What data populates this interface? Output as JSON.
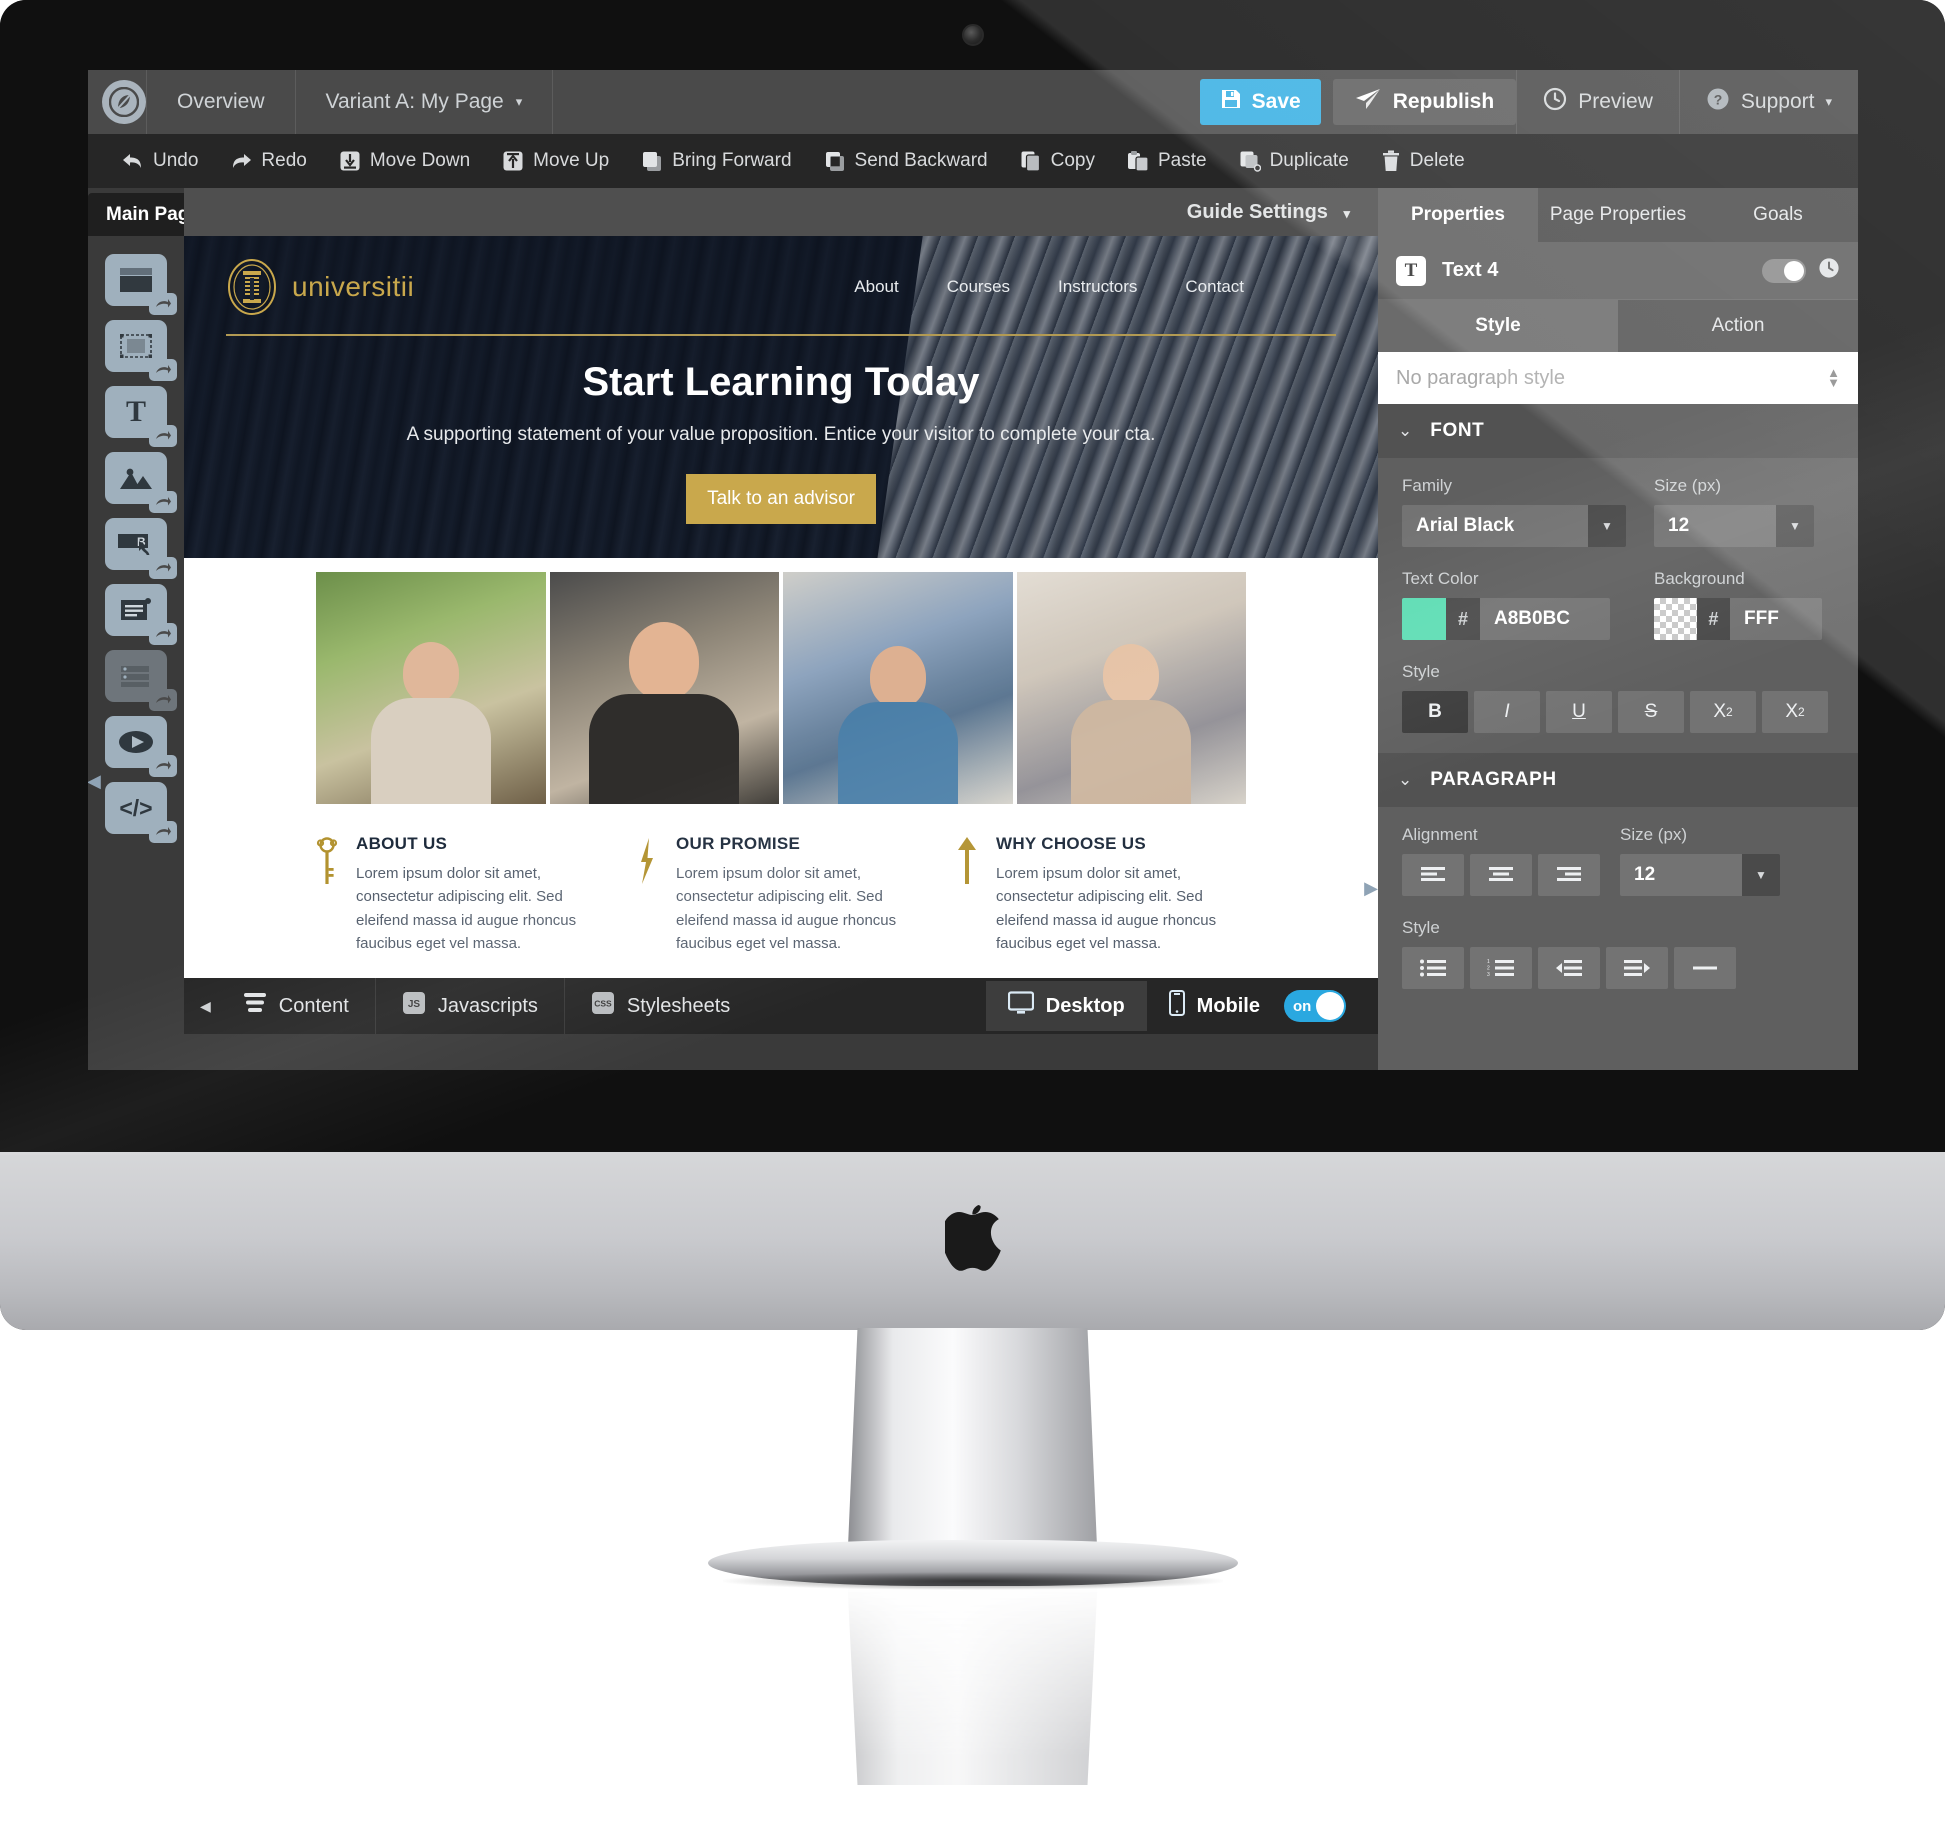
{
  "app": {
    "logo_icon": "leaf-logo-icon",
    "nav": [
      {
        "label": "Overview",
        "name": "overview"
      },
      {
        "label": "Variant A: My Page",
        "name": "variant-selector",
        "caret": "▾"
      }
    ],
    "actions": {
      "save": "Save",
      "republish": "Republish",
      "preview": "Preview",
      "support": "Support",
      "support_caret": "▾"
    }
  },
  "toolbar": {
    "items": [
      {
        "label": "Undo",
        "icon": "undo-icon"
      },
      {
        "label": "Redo",
        "icon": "redo-icon"
      },
      {
        "label": "Move Down",
        "icon": "move-down-icon"
      },
      {
        "label": "Move Up",
        "icon": "move-up-icon"
      },
      {
        "label": "Bring Forward",
        "icon": "bring-forward-icon"
      },
      {
        "label": "Send Backward",
        "icon": "send-backward-icon"
      },
      {
        "label": "Copy",
        "icon": "copy-icon"
      },
      {
        "label": "Paste",
        "icon": "paste-icon"
      },
      {
        "label": "Duplicate",
        "icon": "duplicate-icon"
      },
      {
        "label": "Delete",
        "icon": "trash-icon"
      }
    ]
  },
  "left_panel": {
    "page_tab": "Main Page",
    "tools": [
      {
        "name": "section-tool",
        "icon": "section-block-icon"
      },
      {
        "name": "shape-tool",
        "icon": "marquee-shape-icon"
      },
      {
        "name": "text-tool",
        "icon": "text-T-icon"
      },
      {
        "name": "image-tool",
        "icon": "image-mountain-icon"
      },
      {
        "name": "button-tool",
        "icon": "button-click-icon"
      },
      {
        "name": "form-tool",
        "icon": "form-fields-icon"
      },
      {
        "name": "list-tool",
        "icon": "list-rows-icon",
        "disabled": true
      },
      {
        "name": "video-tool",
        "icon": "video-play-icon"
      },
      {
        "name": "code-tool",
        "icon": "code-brackets-icon"
      }
    ]
  },
  "canvas": {
    "guide_settings": "Guide Settings",
    "guide_settings_caret": "▾",
    "site": {
      "brand": "universitii",
      "brand_emblem_icon": "university-crest-icon",
      "nav": [
        "About",
        "Courses",
        "Instructors",
        "Contact"
      ],
      "hero_heading": "Start Learning Today",
      "hero_subheading": "A supporting statement of your value proposition. Entice your visitor to complete your cta.",
      "hero_cta": "Talk to an advisor",
      "photos": [
        {
          "alt": "student-reading-outdoors"
        },
        {
          "alt": "young-man-portrait"
        },
        {
          "alt": "student-at-laptop"
        },
        {
          "alt": "student-with-backpack"
        }
      ],
      "features": [
        {
          "icon": "key-icon",
          "title": "ABOUT US",
          "body": "Lorem ipsum dolor sit amet, consectetur adipiscing elit. Sed eleifend massa id augue rhoncus faucibus eget vel massa."
        },
        {
          "icon": "lightning-bolt-icon",
          "title": "OUR PROMISE",
          "body": "Lorem ipsum dolor sit amet, consectetur adipiscing elit. Sed eleifend massa id augue rhoncus faucibus eget vel massa."
        },
        {
          "icon": "arrow-up-icon",
          "title": "WHY CHOOSE US",
          "body": "Lorem ipsum dolor sit amet, consectetur adipiscing elit. Sed eleifend massa id augue rhoncus faucibus eget vel massa."
        }
      ]
    }
  },
  "bottom_bar": {
    "collapse_caret": "◀",
    "tabs": [
      {
        "label": "Content",
        "icon": "content-lines-icon"
      },
      {
        "label": "Javascripts",
        "icon": "js-badge-icon"
      },
      {
        "label": "Stylesheets",
        "icon": "css-badge-icon"
      }
    ],
    "views": [
      {
        "label": "Desktop",
        "icon": "monitor-icon",
        "active": true
      },
      {
        "label": "Mobile",
        "icon": "phone-icon",
        "active": false
      }
    ],
    "mobile_toggle": "on"
  },
  "right_panel": {
    "tabs": [
      {
        "label": "Properties",
        "active": true
      },
      {
        "label": "Page Properties",
        "active": false
      },
      {
        "label": "Goals",
        "active": false
      }
    ],
    "layer": {
      "icon": "text-layer-icon",
      "icon_glyph": "T",
      "name": "Text 4",
      "visibility_toggle": "on",
      "history_icon": "clock-history-icon"
    },
    "subtabs": [
      {
        "label": "Style",
        "active": true
      },
      {
        "label": "Action",
        "active": false
      }
    ],
    "paragraph_style": {
      "placeholder": "No paragraph style",
      "value": ""
    },
    "font": {
      "section_title": "FONT",
      "chevron": "⌄",
      "family_label": "Family",
      "family_value": "Arial Black",
      "size_label": "Size (px)",
      "size_value": "12",
      "text_color_label": "Text Color",
      "text_color_swatch": "#5EDDB4",
      "text_color_hash": "#",
      "text_color_hex": "A8B0BC",
      "background_label": "Background",
      "background_swatch": "transparent",
      "background_hash": "#",
      "background_hex": "FFF",
      "style_label": "Style",
      "style_buttons": [
        {
          "label": "B",
          "name": "bold",
          "active": true
        },
        {
          "label": "I",
          "name": "italic",
          "active": false
        },
        {
          "label": "U",
          "name": "underline",
          "active": false
        },
        {
          "label": "S",
          "name": "strikethrough",
          "active": false
        },
        {
          "label": "X",
          "sup": "2",
          "name": "superscript",
          "active": false
        },
        {
          "label": "X",
          "sub": "2",
          "name": "subscript",
          "active": false
        }
      ]
    },
    "paragraph": {
      "section_title": "PARAGRAPH",
      "chevron": "⌄",
      "alignment_label": "Alignment",
      "alignment_buttons": [
        "align-left-icon",
        "align-center-icon",
        "align-right-icon"
      ],
      "size_label": "Size (px)",
      "size_value": "12",
      "style_label": "Style",
      "style_buttons": [
        "bullet-list-icon",
        "numbered-list-icon",
        "outdent-icon",
        "indent-icon",
        "horizontal-rule-icon"
      ]
    }
  },
  "hardware": {
    "brand_logo": "apple-logo",
    "camera": "webcam-icon"
  }
}
